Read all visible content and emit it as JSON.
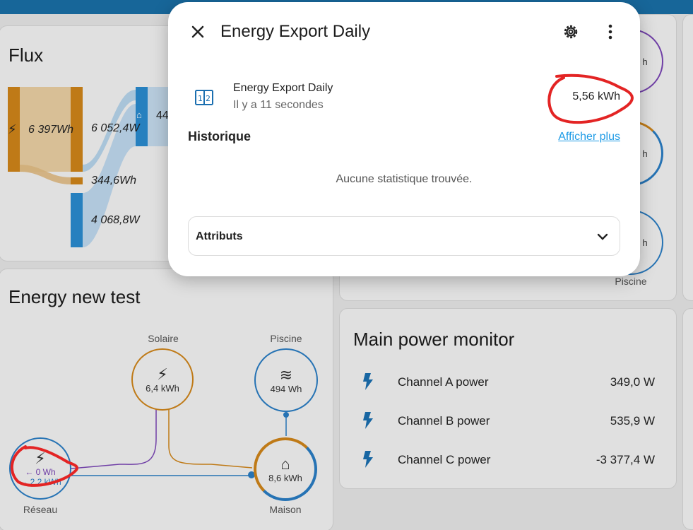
{
  "colors": {
    "accent": "#1e9be6",
    "solar": "#d0851a",
    "grid_blue": "#2a7dc4",
    "purple": "#7a45b5",
    "annotation": "#e32424"
  },
  "flux": {
    "title": "Flux",
    "values": [
      "6 397Wh",
      "6 052,4W",
      "344,6Wh",
      "4 068,8W",
      "44"
    ]
  },
  "energy_test": {
    "title": "Energy new test",
    "solar": {
      "label": "Solaire",
      "value": "6,4 kWh",
      "icon": "solar-power-icon"
    },
    "pool": {
      "label": "Piscine",
      "value": "494 Wh",
      "icon": "pool-icon"
    },
    "grid": {
      "label": "Réseau",
      "value_in": "← 0 Wh",
      "value_out": "→ 2,2 kWh",
      "icon": "transmission-tower-icon"
    },
    "home": {
      "label": "Maison",
      "value": "8,6 kWh",
      "icon": "home-icon"
    }
  },
  "right_partial": {
    "pool_label": "Piscine",
    "h1": "h",
    "h2": "h",
    "h3": "h"
  },
  "monitor": {
    "title": "Main power monitor",
    "rows": [
      {
        "name": "Channel A power",
        "value": "349,0 W"
      },
      {
        "name": "Channel B power",
        "value": "535,9 W"
      },
      {
        "name": "Channel C power",
        "value": "-3 377,4 W"
      }
    ]
  },
  "dialog": {
    "title": "Energy Export Daily",
    "entity_name": "Energy Export Daily",
    "last_changed": "Il y a 11 secondes",
    "state": "5,56 kWh",
    "history_title": "Historique",
    "show_more": "Afficher plus",
    "no_stats": "Aucune statistique trouvée.",
    "attributes": "Attributs"
  }
}
